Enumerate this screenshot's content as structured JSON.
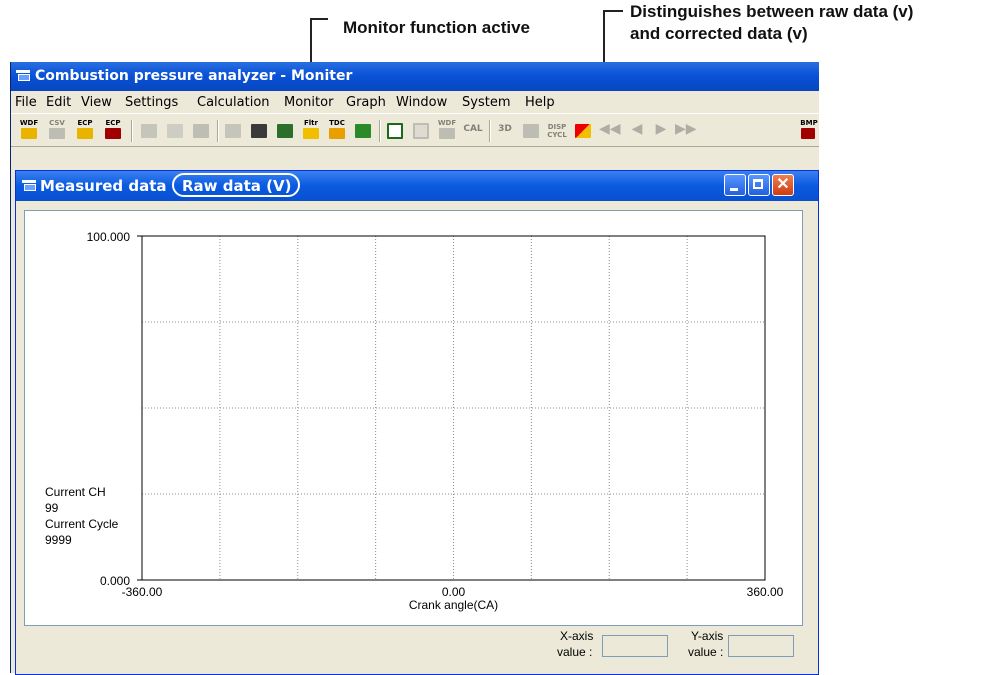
{
  "annotations": {
    "monitor": "Monitor function active",
    "distinguish_line1": "Distinguishes between raw data (v)",
    "distinguish_line2": "and corrected data (v)"
  },
  "app": {
    "title": "Combustion pressure analyzer - Moniter",
    "menu": [
      "File",
      "Edit",
      "View",
      "Settings",
      "Calculation",
      "Monitor",
      "Graph",
      "Window",
      "System",
      "Help"
    ],
    "toolbar_labels": {
      "wdf_open": "WDF",
      "csv": "CSV",
      "ecp_open": "ECP",
      "ecp_save": "ECP",
      "fltr": "Fltr",
      "tdc": "TDC",
      "wdf2": "WDF",
      "cal": "CAL",
      "three_d": "3D",
      "disp_cycl": "DISP CYCL",
      "bmp": "BMP"
    }
  },
  "child_window": {
    "title": "Measured data",
    "mode_label": "Raw data (V)"
  },
  "chart_data": {
    "type": "line",
    "series": [],
    "xlabel": "Crank angle(CA)",
    "xlim": [
      -360,
      360
    ],
    "ylim": [
      0,
      100
    ],
    "x_tick_labels": [
      "-360.00",
      "0.00",
      "360.00"
    ],
    "y_tick_labels": [
      "0.000",
      "100.000"
    ],
    "grid": true,
    "x_grid_divisions": 8,
    "y_grid_divisions": 4
  },
  "overlay": {
    "current_ch_label": "Current CH",
    "current_ch_value": "99",
    "current_cycle_label": "Current Cycle",
    "current_cycle_value": "9999"
  },
  "axis_values": {
    "x_label_1": "X-axis",
    "x_label_2": "value :",
    "x_value": "",
    "y_label_1": "Y-axis",
    "y_label_2": "value :",
    "y_value": ""
  },
  "colors": {
    "title_bar": "#0a52d8",
    "window_face": "#ece9d8",
    "close_button": "#d03a10"
  }
}
